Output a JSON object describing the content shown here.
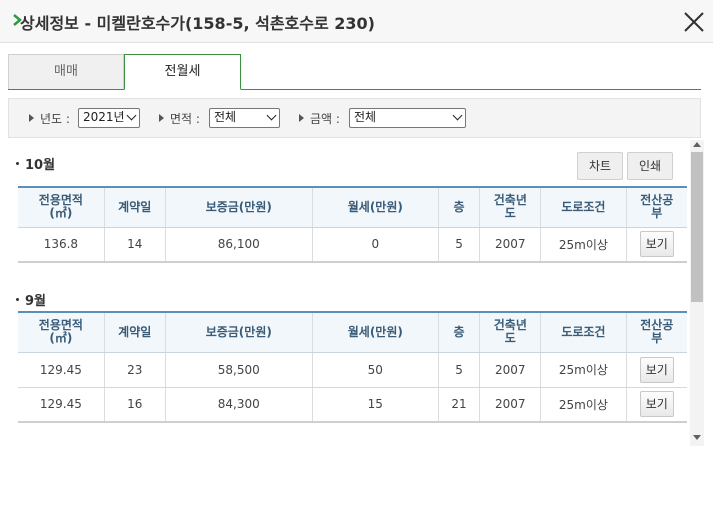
{
  "dialog": {
    "title": "상세정보 - 미켈란호수가(158-5, 석촌호수로 230)"
  },
  "tabs": [
    {
      "label": "매매",
      "active": false
    },
    {
      "label": "전월세",
      "active": true
    }
  ],
  "filters": {
    "year": {
      "label": "년도 :",
      "value": "2021년"
    },
    "area": {
      "label": "면적 :",
      "value": "전체"
    },
    "amount": {
      "label": "금액 :",
      "value": "전체"
    }
  },
  "actions": {
    "chart_label": "차트",
    "print_label": "인쇄"
  },
  "table_headers": {
    "area_line1": "전용면적",
    "area_line2": "(㎡)",
    "contract_day": "계약일",
    "deposit": "보증금(만원)",
    "monthly": "월세(만원)",
    "floor": "층",
    "built_line1": "건축년",
    "built_line2": "도",
    "road": "도로조건",
    "registry_line1": "전산공",
    "registry_line2": "부"
  },
  "sections": [
    {
      "title": "10월",
      "rows": [
        {
          "area": "136.8",
          "day": "14",
          "deposit": "86,100",
          "monthly": "0",
          "floor": "5",
          "built": "2007",
          "road": "25m이상",
          "view": "보기"
        }
      ]
    },
    {
      "title": "9월",
      "rows": [
        {
          "area": "129.45",
          "day": "23",
          "deposit": "58,500",
          "monthly": "50",
          "floor": "5",
          "built": "2007",
          "road": "25m이상",
          "view": "보기"
        },
        {
          "area": "129.45",
          "day": "16",
          "deposit": "84,300",
          "monthly": "15",
          "floor": "21",
          "built": "2007",
          "road": "25m이상",
          "view": "보기"
        }
      ]
    }
  ],
  "colors": {
    "accent_green": "#3c8e3c",
    "header_blue": "#5b8fb8"
  }
}
